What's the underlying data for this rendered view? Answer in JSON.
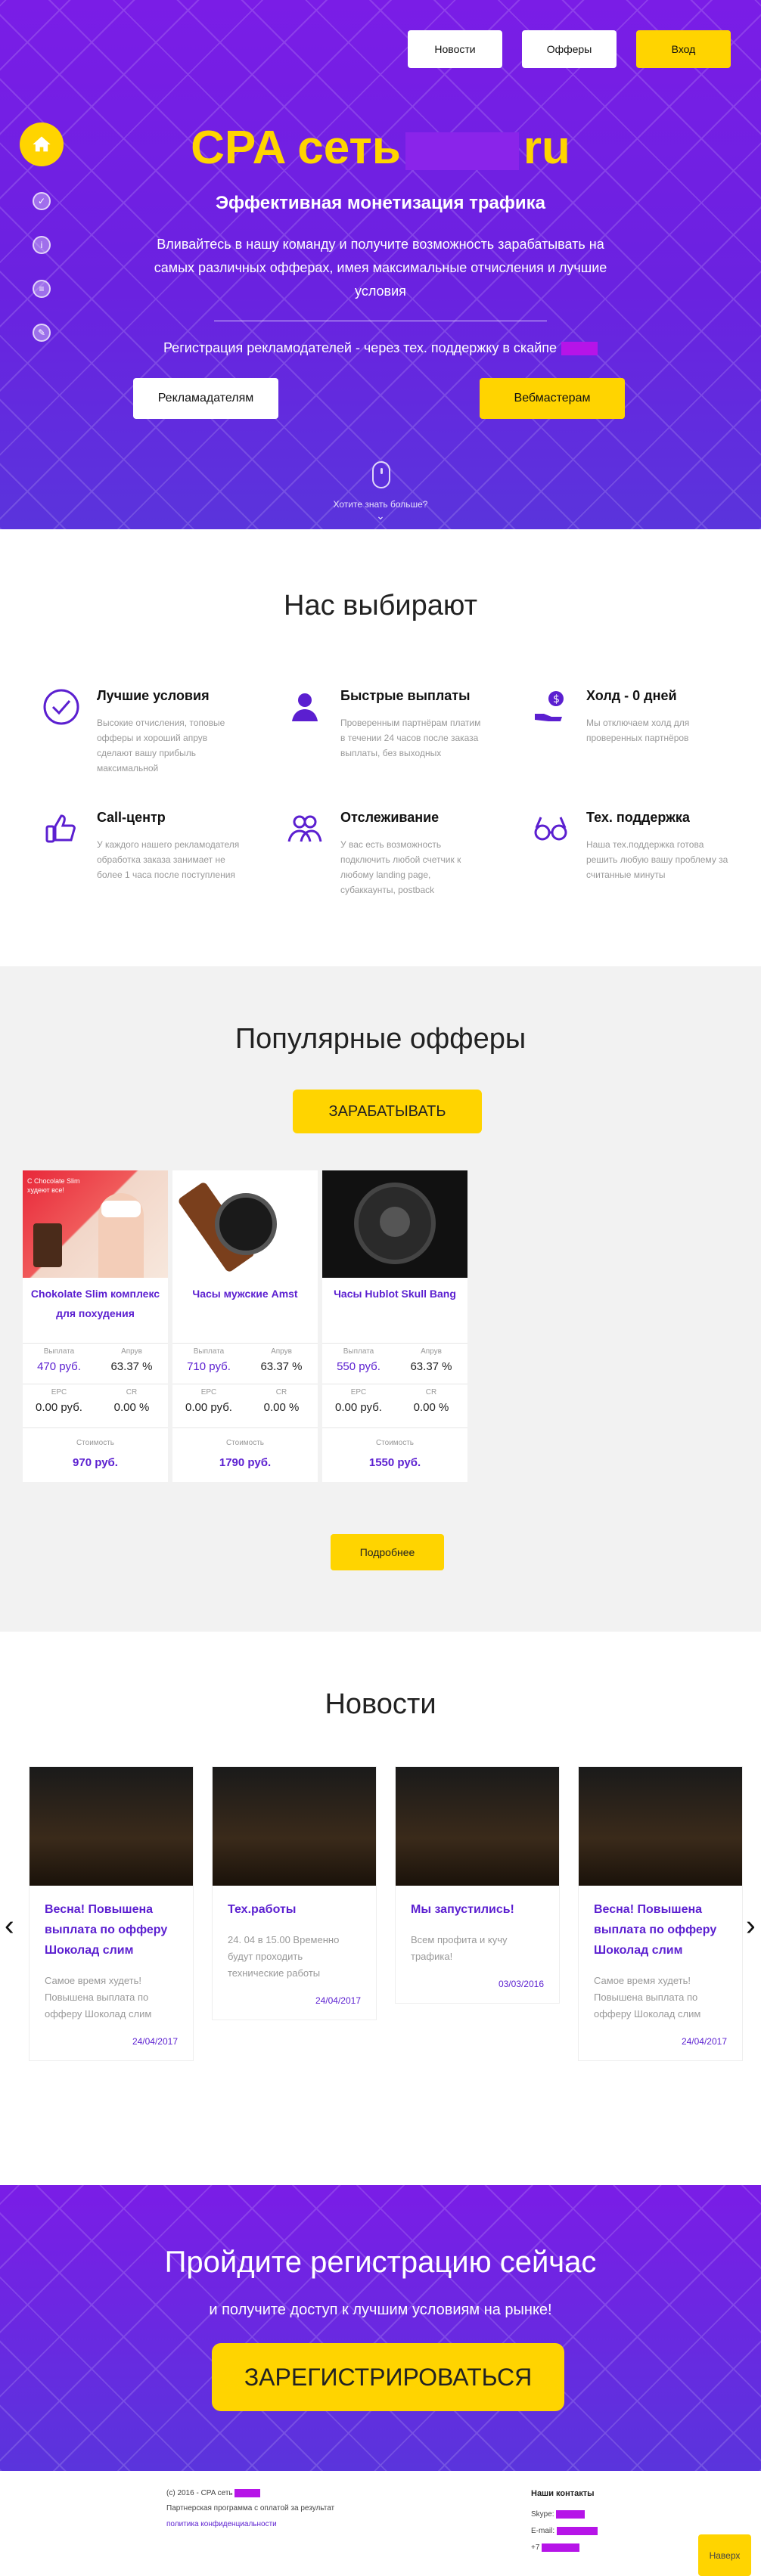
{
  "nav": {
    "items": [
      "Новости",
      "Офферы",
      "Вход"
    ]
  },
  "hero": {
    "logo_left": "CPA сеть",
    "logo_right": "ru",
    "tagline": "Эффективная монетизация трафика",
    "description": "Вливайтесь в нашу команду и получите возможность зарабатывать на самых различных офферах, имея максимальные отчисления и лучшие условия",
    "registration_note": "Регистрация рекламодателей - через тех. поддержку в скайпе",
    "advertisers_button": "Рекламадателям",
    "webmasters_button": "Вебмастерам",
    "more_label": "Хотите знать больше?"
  },
  "why": {
    "title": "Нас выбирают",
    "features": [
      {
        "icon": "check-circle-icon",
        "title": "Лучшие условия",
        "text": "Высокие отчисления, топовые офферы и хороший апрув сделают вашу прибыль максимальной"
      },
      {
        "icon": "user-icon",
        "title": "Быстрые выплаты",
        "text": "Проверенным партнёрам платим в течении 24 часов после заказа выплаты, без выходных"
      },
      {
        "icon": "money-hand-icon",
        "title": "Холд - 0 дней",
        "text": "Мы отключаем холд для проверенных партнёров"
      },
      {
        "icon": "thumbs-up-icon",
        "title": "Call-центр",
        "text": "У каждого нашего рекламодателя обработка заказа занимает не более 1 часа после поступления"
      },
      {
        "icon": "users-icon",
        "title": "Отслеживание",
        "text": "У вас есть возможность подключить любой счетчик к любому landing page, субаккаунты, postback"
      },
      {
        "icon": "support-icon",
        "title": "Тех. поддержка",
        "text": "Наша тех.поддержка готова решить любую вашу проблему за считанные минуты"
      }
    ]
  },
  "offers": {
    "title": "Популярные офферы",
    "earn_button": "ЗАРАБАТЫВАТЬ",
    "labels": {
      "payout": "Выплата",
      "approve": "Апрув",
      "epc": "EPC",
      "cr": "CR",
      "cost": "Стоимость"
    },
    "cards": [
      {
        "title": "Chokolate Slim комплекс для похудения",
        "payout": "470 руб.",
        "approve": "63.37 %",
        "epc": "0.00 руб.",
        "cr": "0.00 %",
        "cost": "970 руб.",
        "badge": "C Chocolate Slim худеют все!"
      },
      {
        "title": "Часы мужские Amst",
        "payout": "710 руб.",
        "approve": "63.37 %",
        "epc": "0.00 руб.",
        "cr": "0.00 %",
        "cost": "1790 руб."
      },
      {
        "title": "Часы Hublot Skull Bang",
        "payout": "550 руб.",
        "approve": "63.37 %",
        "epc": "0.00 руб.",
        "cr": "0.00 %",
        "cost": "1550 руб."
      }
    ],
    "more_button": "Подробнее"
  },
  "news": {
    "title": "Новости",
    "items": [
      {
        "title": "Весна! Повышена выплата по офферу Шоколад слим",
        "text": "Самое время худеть! Повышена выплата по офферу Шоколад слим",
        "date": "24/04/2017"
      },
      {
        "title": "Тех.работы",
        "text": "24. 04 в 15.00 Временно будут проходить технические работы",
        "date": "24/04/2017"
      },
      {
        "title": "Мы запустились!",
        "text": "Всем профита и кучу трафика!",
        "date": "03/03/2016"
      },
      {
        "title": "Весна! Повышена выплата по офферу Шоколад слим",
        "text": "Самое время худеть! Повышена выплата по офферу Шоколад слим",
        "date": "24/04/2017"
      }
    ]
  },
  "register": {
    "title": "Пройдите регистрацию сейчас",
    "subtitle": "и получите доступ к лучшим условиям на рынке!",
    "button": "ЗАРЕГИСТРИРОВАТЬСЯ"
  },
  "footer": {
    "copyright": "(c) 2016 - CPA сеть",
    "program": "Партнерская программа с оплатой за результат",
    "privacy": "политика конфиденциальности",
    "contacts_title": "Наши контакты",
    "skype_label": "Skype:",
    "email_label": "E-mail:",
    "phone_label": "+7",
    "top_button": "Наверх"
  },
  "colors": {
    "brand": "#7a1de6",
    "accent": "#ffd400",
    "link": "#5b1fd0"
  }
}
